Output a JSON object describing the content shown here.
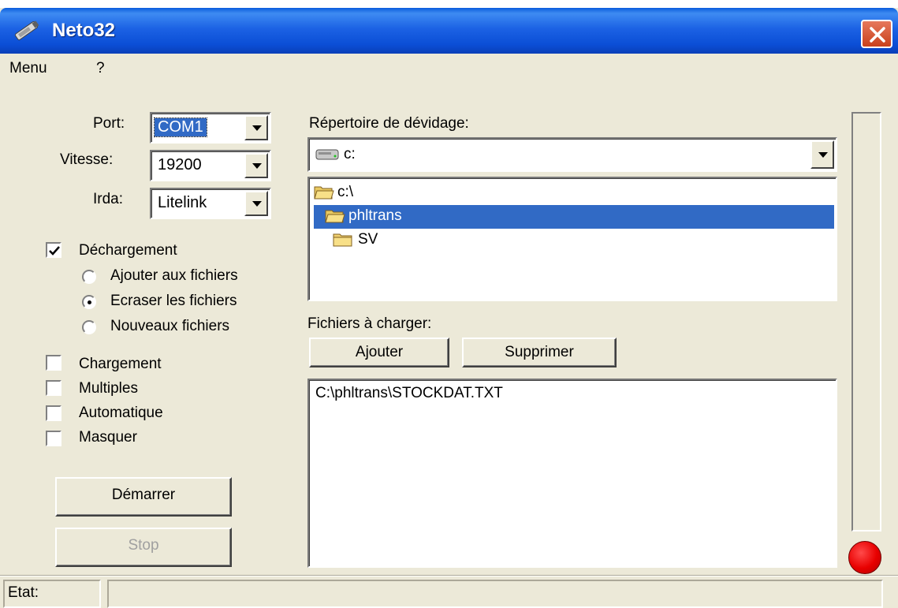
{
  "window": {
    "title": "Neto32"
  },
  "menu": {
    "items": [
      "Menu",
      "?"
    ]
  },
  "settings": {
    "port_label": "Port:",
    "port_value": "COM1",
    "speed_label": "Vitesse:",
    "speed_value": "19200",
    "irda_label": "Irda:",
    "irda_value": "Litelink"
  },
  "download": {
    "label": "Déchargement",
    "checked": true,
    "options": [
      {
        "label": "Ajouter aux fichiers",
        "selected": false
      },
      {
        "label": "Ecraser les fichiers",
        "selected": true
      },
      {
        "label": "Nouveaux fichiers",
        "selected": false
      }
    ]
  },
  "checkboxes": [
    {
      "label": "Chargement",
      "checked": false
    },
    {
      "label": "Multiples",
      "checked": false
    },
    {
      "label": "Automatique",
      "checked": false
    },
    {
      "label": "Masquer",
      "checked": false
    }
  ],
  "buttons": {
    "start": "Démarrer",
    "stop": "Stop",
    "add": "Ajouter",
    "remove": "Supprimer"
  },
  "directory": {
    "label": "Répertoire de dévidage:",
    "drive": "c:",
    "tree": [
      {
        "label": "c:\\",
        "open": true,
        "selected": false,
        "indent": 0
      },
      {
        "label": "phltrans",
        "open": true,
        "selected": true,
        "indent": 1
      },
      {
        "label": "SV",
        "open": false,
        "selected": false,
        "indent": 1
      }
    ]
  },
  "files": {
    "label": "Fichiers à charger:",
    "items": [
      "C:\\phltrans\\STOCKDAT.TXT"
    ]
  },
  "status": {
    "label": "Etat:",
    "text": ""
  },
  "progress": 0,
  "colors": {
    "titlebar": "#0a4ed6",
    "face": "#ece9d8",
    "selection": "#316ac5",
    "led": "#e80000",
    "close": "#d8532e"
  }
}
